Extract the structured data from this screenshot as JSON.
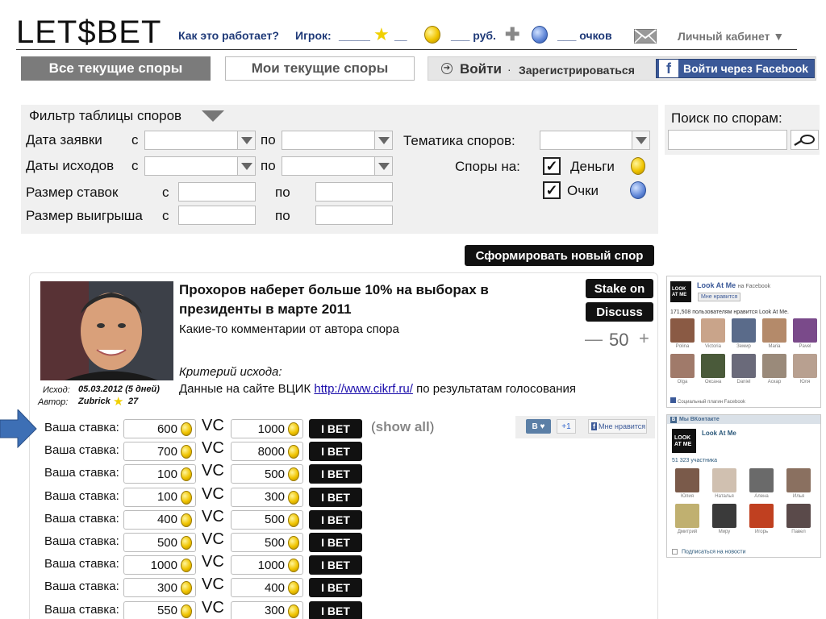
{
  "header": {
    "logo": "LET$BET",
    "how_it_works": "Как это работает?",
    "player_label": "Игрок:",
    "player_value": "_____",
    "star_value": "__",
    "rub_value": "___ руб.",
    "points_value": "___ очков",
    "cabinet": "Личный кабинет"
  },
  "tabs": {
    "all_disputes": "Все текущие споры",
    "my_disputes": "Мои текущие споры"
  },
  "auth": {
    "login": "Войти",
    "dot": "·",
    "register": "Зарегистрироваться",
    "facebook_login": "Войти через Facebook"
  },
  "filter": {
    "title": "Фильтр таблицы споров",
    "date_label": "Дата заявки",
    "outcome_dates_label": "Даты исходов",
    "stake_size_label": "Размер ставок",
    "win_size_label": "Размер выигрыша",
    "from": "с",
    "to": "по",
    "topic_label": "Тематика споров:",
    "disputes_on_label": "Споры на:",
    "money": "Деньги",
    "points": "Очки"
  },
  "search": {
    "title": "Поиск по спорам:"
  },
  "new_dispute_button": "Сформировать новый спор",
  "dispute": {
    "title": "Прохоров наберет больше 10% на выборах в президенты в марте 2011",
    "comment": "Какие-то комментарии от автора спора",
    "criterion_label": "Критерий исхода:",
    "criterion_text_pre": "Данные на сайте ВЦИК",
    "criterion_link": "http://www.cikrf.ru/",
    "criterion_text_post": "по результатам голосования",
    "outcome_label": "Исход:",
    "outcome_value": "05.03.2012 (5 дней)",
    "author_label": "Автор:",
    "author_value": "Zubrick",
    "author_rating": "27",
    "stake_on": "Stake on",
    "discuss": "Discuss",
    "counter": "50",
    "minus": "—",
    "plus": "+",
    "show_all": "show all"
  },
  "bets": {
    "label": "Ваша ставка:",
    "vs": "VC",
    "button": "I BET",
    "rows": [
      {
        "stake": "600",
        "win": "1000"
      },
      {
        "stake": "700",
        "win": "8000"
      },
      {
        "stake": "100",
        "win": "500"
      },
      {
        "stake": "100",
        "win": "300"
      },
      {
        "stake": "400",
        "win": "500"
      },
      {
        "stake": "500",
        "win": "500"
      },
      {
        "stake": "1000",
        "win": "1000"
      },
      {
        "stake": "300",
        "win": "400"
      },
      {
        "stake": "550",
        "win": "300"
      }
    ]
  },
  "social_share": {
    "vk": "В",
    "plus_one": "+1",
    "fb_like": "Мне нравится"
  },
  "fb_widget": {
    "name": "Look At Me",
    "suffix": "на Facebook",
    "like": "Мне нравится",
    "count_text": "171,508 пользователям нравится Look At Me.",
    "people": [
      "Polina",
      "Victoria",
      "Земир",
      "Maria",
      "Pavel",
      "Olga",
      "Оксана",
      "Daniel",
      "Аскар",
      "Юля"
    ],
    "plugin": "Социальный плагин Facebook"
  },
  "vk_widget": {
    "header": "Мы ВКонтакте",
    "name": "Look At Me",
    "count_text": "51 323 участника",
    "people": [
      "Юлия",
      "Наталья",
      "Алена",
      "Илья",
      "Дмитрий",
      "Миру",
      "Игорь",
      "Павел"
    ],
    "subscribe": "Подписаться на новости"
  },
  "colors": {
    "nav_blue": "#1f3a78",
    "facebook": "#3b5998",
    "arrow": "#3d6fb5"
  }
}
